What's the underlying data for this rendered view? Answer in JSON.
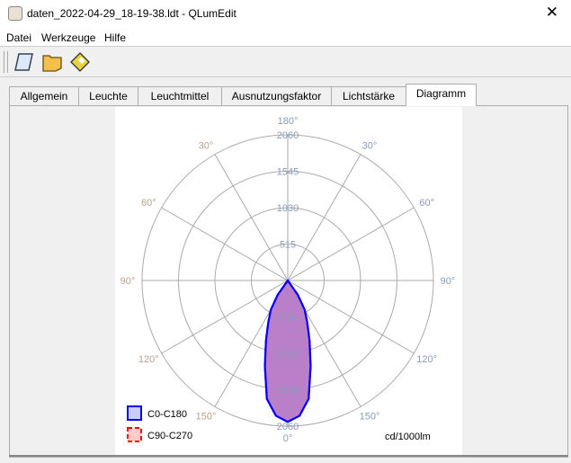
{
  "window": {
    "title": "daten_2022-04-29_18-19-38.ldt - QLumEdit",
    "close": "✕"
  },
  "menu": [
    "Datei",
    "Werkzeuge",
    "Hilfe"
  ],
  "toolbar": [
    "new-icon",
    "open-icon",
    "save-icon"
  ],
  "tabs": [
    "Allgemein",
    "Leuchte",
    "Leuchtmittel",
    "Ausnutzungsfaktor",
    "Lichtstärke",
    "Diagramm"
  ],
  "active_tab": "Diagramm",
  "chart_data": {
    "type": "polar",
    "rmax": 2060,
    "rings": [
      "515",
      "1030",
      "1545",
      "2060"
    ],
    "angle_labels_left": [
      "150°",
      "120°",
      "90°",
      "60°",
      "30°"
    ],
    "angle_labels_right": [
      "150°",
      "120°",
      "90°",
      "60°",
      "30°"
    ],
    "top_label": "180°",
    "bottom_label": "0°",
    "bottom_ring_label": "2060",
    "unit": "cd/1000lm",
    "gamma": [
      0,
      5,
      10,
      15,
      20,
      25,
      30,
      35,
      40
    ],
    "series": [
      {
        "name": "C90-C270",
        "color": "#ff0000",
        "fill": "#ffcccc",
        "values": [
          2000,
          1920,
          1700,
          1250,
          900,
          650,
          480,
          250,
          0
        ]
      },
      {
        "name": "C0-C180",
        "color": "#0000ff",
        "fill": "#ccccff",
        "values": [
          2000,
          1920,
          1700,
          1250,
          900,
          650,
          480,
          250,
          0
        ]
      }
    ]
  }
}
